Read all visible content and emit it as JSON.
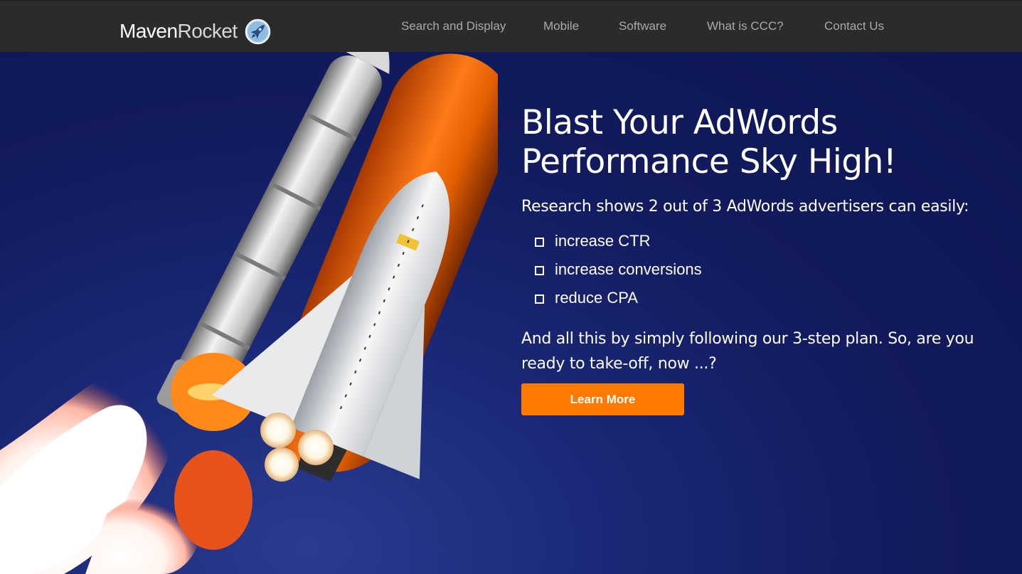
{
  "nav": {
    "brand_bold": "Maven",
    "brand_light": "Rocket",
    "brand_icon": "rocket-icon",
    "links": [
      "Search and Display",
      "Mobile",
      "Software",
      "What is CCC?",
      "Contact Us"
    ]
  },
  "hero": {
    "headline": "Blast Your AdWords Performance Sky High!",
    "intro": "Research shows 2 out of 3 AdWords advertisers can easily:",
    "benefits": [
      "increase CTR",
      "increase conversions",
      "reduce CPA"
    ],
    "closing": "And all this by simply following our 3-step plan. So, are you ready to take-off, now ...?",
    "cta_label": "Learn More"
  },
  "colors": {
    "navbar": "#2b2b2a",
    "hero_background": "#121b5e",
    "cta": "#ff7a00",
    "nav_link": "#a9a9a9"
  }
}
